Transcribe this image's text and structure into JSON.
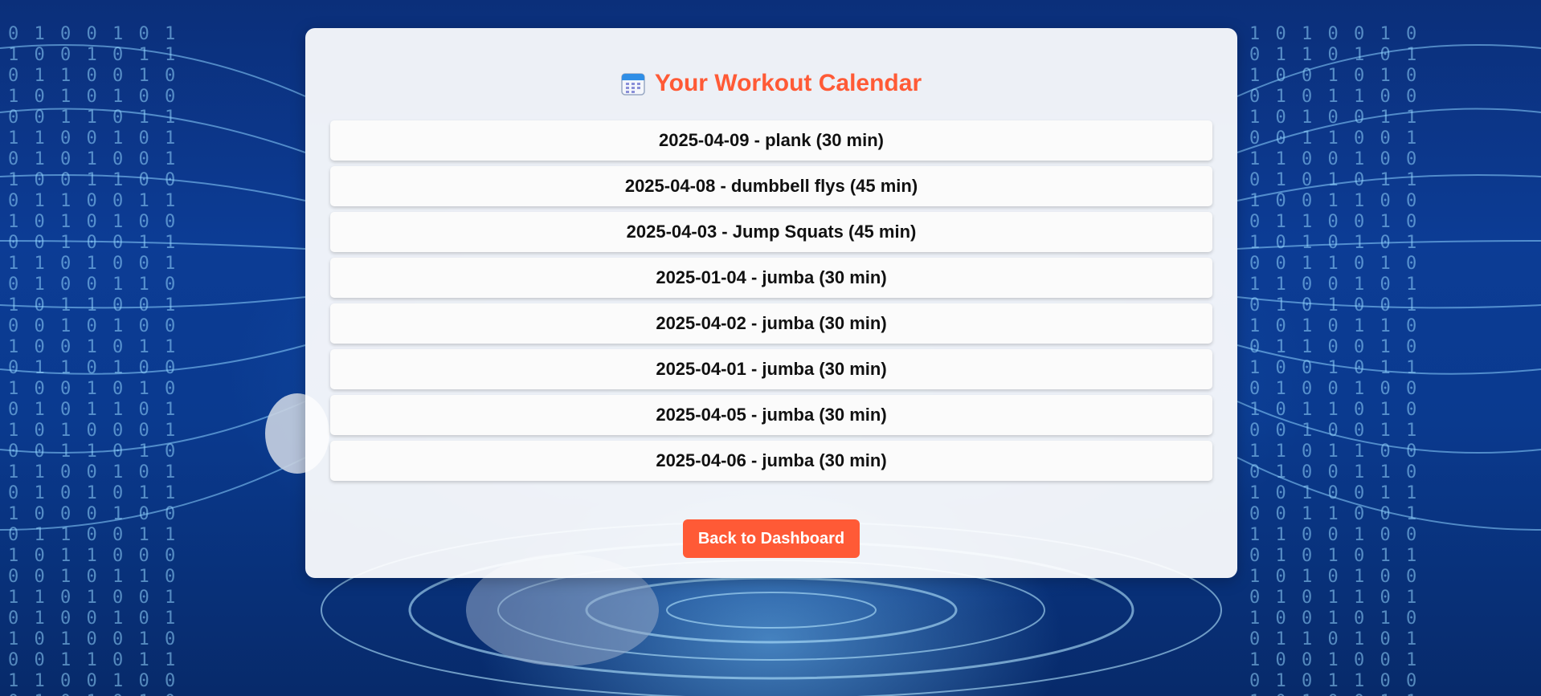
{
  "page": {
    "title": "Your Workout Calendar",
    "title_icon": "calendar-icon"
  },
  "workouts": [
    {
      "label": "2025-04-09 - plank (30 min)"
    },
    {
      "label": "2025-04-08 - dumbbell flys (45 min)"
    },
    {
      "label": "2025-04-03 - Jump Squats (45 min)"
    },
    {
      "label": "2025-01-04 - jumba (30 min)"
    },
    {
      "label": "2025-04-02 - jumba (30 min)"
    },
    {
      "label": "2025-04-01 - jumba (30 min)"
    },
    {
      "label": "2025-04-05 - jumba (30 min)"
    },
    {
      "label": "2025-04-06 - jumba (30 min)"
    }
  ],
  "actions": {
    "back_label": "Back to Dashboard"
  },
  "colors": {
    "accent": "#ff5a36",
    "card_bg": "#ffffff",
    "background": "#0b3a8f"
  }
}
